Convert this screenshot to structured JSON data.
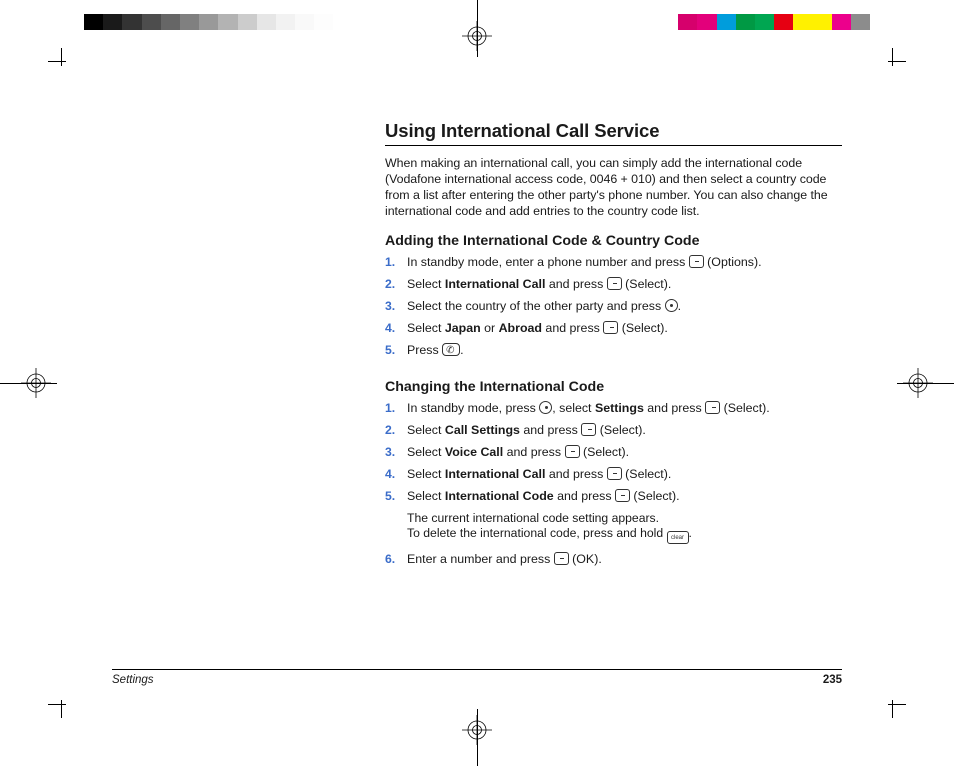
{
  "printer_bars": {
    "gray_swatches": [
      "#000000",
      "#1a1a1a",
      "#333333",
      "#4d4d4d",
      "#666666",
      "#808080",
      "#999999",
      "#b3b3b3",
      "#cccccc",
      "#e6e6e6",
      "#f2f2f2",
      "#f9f9f9",
      "#fdfdfd",
      "#ffffff"
    ],
    "color_swatches": [
      "#d6006c",
      "#e3007b",
      "#009ddc",
      "#009944",
      "#00a651",
      "#e60012",
      "#fff100",
      "#fff100",
      "#ec008c",
      "#8c8c8c"
    ]
  },
  "heading": "Using International Call Service",
  "intro": "When making an international call, you can simply add the international code (Vodafone international access code, 0046 + 010) and then select a country code from a list after entering the other party's phone number. You can also change the international code and add entries to the country code list.",
  "section_a": {
    "title": "Adding the International Code & Country Code",
    "steps": {
      "s1_a": "In standby mode, enter a phone number and press ",
      "s1_b": " (Options).",
      "s2_a": "Select ",
      "s2_b1": "International Call",
      "s2_c": " and press ",
      "s2_d": " (Select).",
      "s3_a": "Select the country of the other party and press ",
      "s3_b": ".",
      "s4_a": "Select ",
      "s4_b1": "Japan",
      "s4_mid": " or ",
      "s4_b2": "Abroad",
      "s4_c": " and press ",
      "s4_d": " (Select).",
      "s5_a": "Press ",
      "s5_b": "."
    }
  },
  "section_b": {
    "title": "Changing the International Code",
    "steps": {
      "s1_a": "In standby mode, press ",
      "s1_b": ", select ",
      "s1_c": "Settings",
      "s1_d": " and press ",
      "s1_e": " (Select).",
      "s2_a": "Select ",
      "s2_b": "Call Settings",
      "s2_c": " and press ",
      "s2_d": " (Select).",
      "s3_a": "Select ",
      "s3_b": "Voice Call",
      "s3_c": " and press ",
      "s3_d": " (Select).",
      "s4_a": "Select ",
      "s4_b": "International Call",
      "s4_c": " and press ",
      "s4_d": " (Select).",
      "s5_a": "Select ",
      "s5_b": "International Code",
      "s5_c": " and press ",
      "s5_d": " (Select).",
      "note1": "The current international code setting appears.",
      "note2_a": "To delete the international code, press and hold ",
      "note2_b": ".",
      "s6_a": "Enter a number and press ",
      "s6_b": " (OK)."
    }
  },
  "footer": {
    "section": "Settings",
    "page": "235"
  }
}
